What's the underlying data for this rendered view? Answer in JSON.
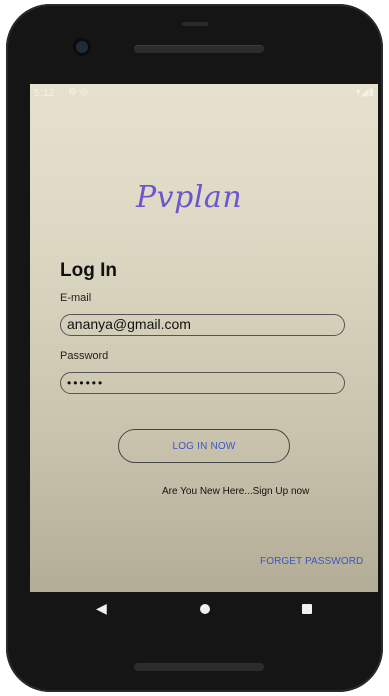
{
  "status_bar": {
    "time": "5:12",
    "left_icons": "⚙ ◎",
    "right_icons": "▾◢▮"
  },
  "app": {
    "logo_text": "Pvplan"
  },
  "login": {
    "title": "Log In",
    "email_label": "E-mail",
    "email_value": "ananya@gmail.com",
    "password_label": "Password",
    "password_value": "••••••",
    "login_button": "LOG IN NOW",
    "signup_text": "Are You New Here...Sign Up now",
    "forgot_text": "FORGET PASSWORD"
  },
  "colors": {
    "accent": "#3d56c2",
    "logo": "#6c55cf"
  }
}
